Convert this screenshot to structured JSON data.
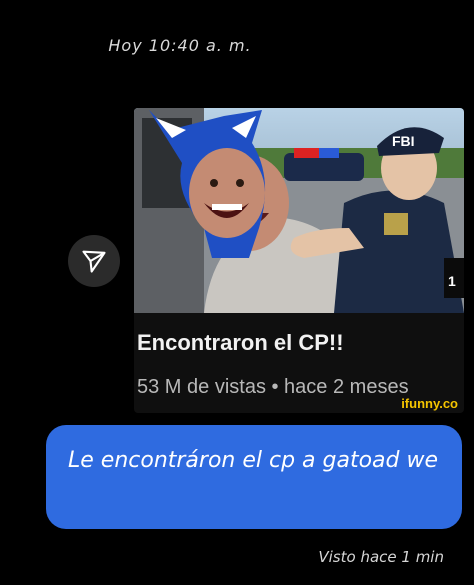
{
  "chat": {
    "timestamp": "Hoy 10:40 a. m.",
    "share_icon": "paper-plane-icon",
    "shared_post": {
      "title": "Encontraron el CP!!",
      "meta": "53 M de vistas • hace 2 meses",
      "watermark": "ifunny.co",
      "badge": "FBI"
    },
    "message": {
      "text": "Le encontráron el cp a gatoad we",
      "bubble_color": "#2f6be0"
    },
    "seen_status": "Visto hace 1 min"
  }
}
